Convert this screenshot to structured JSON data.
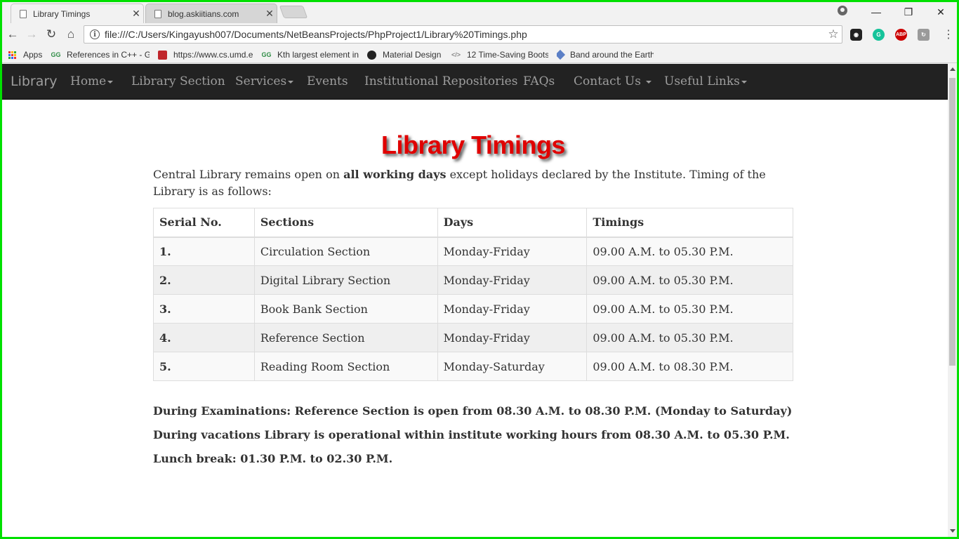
{
  "browser": {
    "tabs": [
      {
        "title": "Library Timings",
        "close": "✕"
      },
      {
        "title": "blog.askiitians.com",
        "close": "✕"
      }
    ],
    "window_controls": {
      "minimize": "—",
      "restore": "❐",
      "close": "✕"
    },
    "url": "file:///C:/Users/Kingayush007/Documents/NetBeansProjects/PhpProject1/Library%20Timings.php",
    "extensions": [
      "ABP"
    ],
    "bookmarks": [
      {
        "label": "Apps",
        "icon": "apps-grid-icon"
      },
      {
        "label": "References in C++ - G",
        "icon": "geeksforgeeks-icon"
      },
      {
        "label": "https://www.cs.umd.e",
        "icon": "cube-icon"
      },
      {
        "label": "Kth largest element in",
        "icon": "geeksforgeeks-icon"
      },
      {
        "label": "Material Design",
        "icon": "github-icon"
      },
      {
        "label": "12 Time-Saving Boots",
        "icon": "code-icon"
      },
      {
        "label": "Band around the Earth",
        "icon": "blue-ribbon-icon"
      }
    ]
  },
  "site": {
    "brand": "Library",
    "nav": [
      {
        "label": "Home",
        "dropdown": true
      },
      {
        "label": "Library Section",
        "dropdown": false
      },
      {
        "label": "Services",
        "dropdown": true
      },
      {
        "label": "Events",
        "dropdown": false
      },
      {
        "label": "Institutional Repositories",
        "dropdown": false
      },
      {
        "label": "FAQs",
        "dropdown": false
      },
      {
        "label": "Contact Us ",
        "dropdown": true
      },
      {
        "label": "Useful Links",
        "dropdown": true
      }
    ]
  },
  "page": {
    "title": "Library Timings",
    "intro_prefix": "Central Library remains open on ",
    "intro_bold": "all working days",
    "intro_suffix": " except holidays declared by the Institute. Timing of the Library is as follows:",
    "table": {
      "headers": [
        "Serial No.",
        "Sections",
        "Days",
        "Timings"
      ],
      "rows": [
        [
          "1.",
          "Circulation Section",
          "Monday-Friday",
          "09.00 A.M. to 05.30 P.M."
        ],
        [
          "2.",
          "Digital Library Section",
          "Monday-Friday",
          "09.00 A.M. to 05.30 P.M."
        ],
        [
          "3.",
          "Book Bank Section",
          "Monday-Friday",
          "09.00 A.M. to 05.30 P.M."
        ],
        [
          "4.",
          "Reference Section",
          "Monday-Friday",
          "09.00 A.M. to 05.30 P.M."
        ],
        [
          "5.",
          "Reading Room Section",
          "Monday-Saturday",
          "09.00 A.M. to 08.30 P.M."
        ]
      ]
    },
    "notes": [
      "During Examinations: Reference Section is open from 08.30 A.M. to 08.30 P.M. (Monday to Saturday)",
      "During vacations Library is operational within institute working hours from 08.30 A.M. to 05.30 P.M.",
      "Lunch break: 01.30 P.M. to 02.30 P.M."
    ]
  },
  "colors": {
    "navbar_bg": "#222222",
    "nav_text": "#9d9d9d",
    "title_red": "#e00000",
    "desktop_green": "#00e000"
  }
}
